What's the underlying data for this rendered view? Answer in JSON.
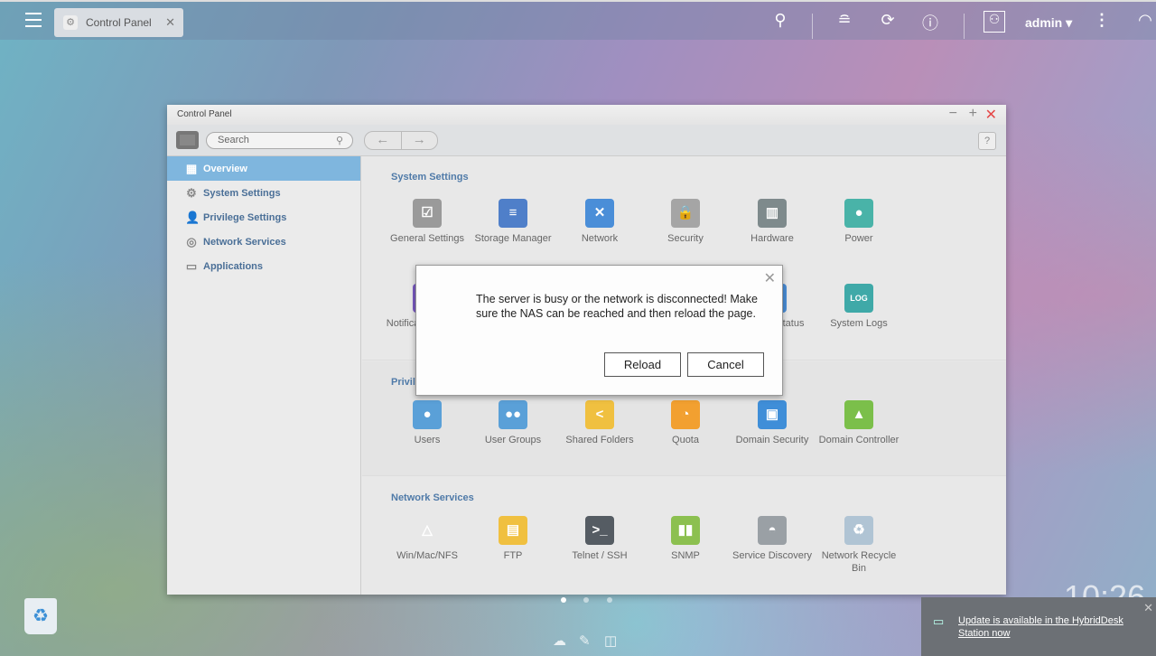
{
  "topbar": {
    "tab_label": "Control Panel",
    "user": "admin ▾",
    "icons": [
      "menu-icon",
      "search-icon",
      "stack-icon",
      "sync-icon",
      "info-icon",
      "user-icon",
      "more-icon",
      "dashboard-icon"
    ]
  },
  "window": {
    "title": "Control Panel",
    "search_placeholder": "Search",
    "help": "?"
  },
  "sidebar": {
    "items": [
      {
        "label": "Overview",
        "icon": "▦"
      },
      {
        "label": "System Settings",
        "icon": "⚙"
      },
      {
        "label": "Privilege Settings",
        "icon": "👤"
      },
      {
        "label": "Network Services",
        "icon": "◎"
      },
      {
        "label": "Applications",
        "icon": "▭"
      }
    ]
  },
  "sections": {
    "system": {
      "title": "System Settings",
      "apps": [
        {
          "label": "General Settings",
          "glyph": "☑",
          "color": "#9a9a9a"
        },
        {
          "label": "Storage Manager",
          "glyph": "≡",
          "color": "#4f7fc9"
        },
        {
          "label": "Network",
          "glyph": "✕",
          "color": "#4a8ed8"
        },
        {
          "label": "Security",
          "glyph": "🔒",
          "color": "#a5a5a5"
        },
        {
          "label": "Hardware",
          "glyph": "▥",
          "color": "#7e8a8c"
        },
        {
          "label": "Power",
          "glyph": "●",
          "color": "#49b3a8"
        }
      ],
      "apps2": [
        {
          "label": "Notification Center",
          "glyph": "!",
          "color": "#7b5bc4"
        },
        {
          "label": "System Status",
          "glyph": "▤",
          "color": "#4a8ed8"
        },
        {
          "label": "System Logs",
          "glyph": "LOG",
          "color": "#3fa9a8"
        }
      ]
    },
    "privilege": {
      "title": "Privilege Settings",
      "apps": [
        {
          "label": "Users",
          "glyph": "●",
          "color": "#5aa0d8"
        },
        {
          "label": "User Groups",
          "glyph": "●●",
          "color": "#5aa0d8"
        },
        {
          "label": "Shared Folders",
          "glyph": "<",
          "color": "#f0c040"
        },
        {
          "label": "Quota",
          "glyph": "◔",
          "color": "#f2a030"
        },
        {
          "label": "Domain Security",
          "glyph": "▣",
          "color": "#3f8ed8"
        },
        {
          "label": "Domain Controller",
          "glyph": "▲",
          "color": "#7bbf4a"
        }
      ]
    },
    "network": {
      "title": "Network Services",
      "apps": [
        {
          "label": "Win/Mac/NFS",
          "glyph": "△",
          "color": "#e8e8e8"
        },
        {
          "label": "FTP",
          "glyph": "▤",
          "color": "#f0c040"
        },
        {
          "label": "Telnet / SSH",
          "glyph": ">_",
          "color": "#555c63"
        },
        {
          "label": "SNMP",
          "glyph": "▮▮",
          "color": "#8cc050"
        },
        {
          "label": "Service Discovery",
          "glyph": "◓",
          "color": "#9aa0a5"
        },
        {
          "label": "Network Recycle Bin",
          "glyph": "♻",
          "color": "#b0c4d4"
        }
      ]
    }
  },
  "dialog": {
    "message": "The server is busy or the network is disconnected! Make sure the NAS can be reached and then reload the page.",
    "reload": "Reload",
    "cancel": "Cancel"
  },
  "clock": "10:26",
  "notification": {
    "text": "Update is available in the HybridDesk Station now"
  }
}
